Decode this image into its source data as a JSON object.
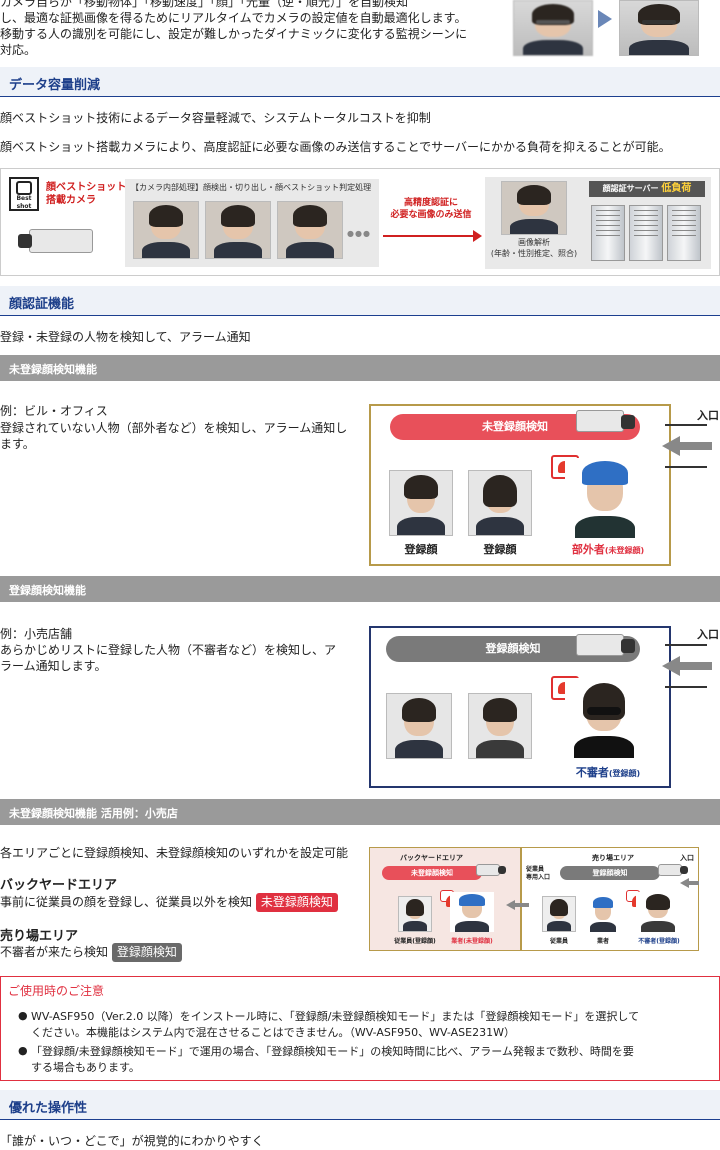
{
  "intro": {
    "line1": "カメラ自らが「移動物体」「移動速度」「顔」「光量（逆・順光）」を自動検知",
    "line2": "し、最適な証拠画像を得るためにリアルタイムでカメラの設定値を自動最適化します。",
    "line3": "移動する人の識別を可能にし、設定が難しかったダイナミックに変化する監視シーンに",
    "line4": "対応。"
  },
  "data_reduction": {
    "title": "データ容量削減",
    "p1": "顔ベストショット技術によるデータ容量軽減で、システムトータルコストを抑制",
    "p2": "顔ベストショット搭載カメラにより、高度認証に必要な画像のみ送信することでサーバーにかかる負荷を抑えることが可能。",
    "diagram": {
      "badge": "Best shot",
      "camera_label_1": "顔ベストショット",
      "camera_label_2": "搭載カメラ",
      "process_label": "【カメラ内部処理】顔検出・切り出し・顔ベストショット判定処理",
      "dots": "●●●",
      "arrow_label_1": "高精度認証に",
      "arrow_label_2": "必要な画像のみ送信",
      "analysis_1": "画像解析",
      "analysis_2": "(年齢・性別推定、照合)",
      "server_label": "顔認証サーバー",
      "server_load": "低負荷"
    }
  },
  "face_auth": {
    "title": "顔認証機能",
    "desc": "登録・未登録の人物を検知して、アラーム通知"
  },
  "unregistered": {
    "header": "未登録顔検知機能",
    "example": "例：ビル・オフィス",
    "desc_1": "登録されていない人物（部外者など）を検知し、アラーム通知し",
    "desc_2": "ます。",
    "pill": "未登録顔検知",
    "entrance": "入口",
    "label_reg1": "登録顔",
    "label_reg2": "登録顔",
    "label_outsider": "部外者",
    "label_outsider_sub": "(未登録顔)"
  },
  "registered": {
    "header": "登録顔検知機能",
    "example": "例：小売店舗",
    "desc_1": "あらかじめリストに登録した人物（不審者など）を検知し、ア",
    "desc_2": "ラーム通知します。",
    "pill": "登録顔検知",
    "entrance": "入口",
    "label_suspicious": "不審者",
    "label_suspicious_sub": "(登録顔)"
  },
  "retail_case": {
    "header": "未登録顔検知機能 活用例：小売店",
    "desc": "各エリアごとに登録顔検知、未登録顔検知のいずれかを設定可能",
    "backyard_title": "バックヤードエリア",
    "backyard_desc": "事前に従業員の顔を登録し、従業員以外を検知",
    "backyard_tag": "未登録顔検知",
    "floor_title": "売り場エリア",
    "floor_desc": "不審者が来たら検知",
    "floor_tag": "登録顔検知",
    "diagram": {
      "backyard_area": "バックヤードエリア",
      "floor_area": "売り場エリア",
      "pill_unreg": "未登録顔検知",
      "pill_reg": "登録顔検知",
      "staff_entrance_1": "従業員",
      "staff_entrance_2": "専用入口",
      "entrance": "入口",
      "l_staff_reg": "従業員",
      "l_staff_reg_sub": "(登録顔)",
      "l_vendor": "業者",
      "l_vendor_sub": "(未登録顔)",
      "l_staff": "従業員",
      "l_vendor2": "業者",
      "l_susp": "不審者",
      "l_susp_sub": "(登録顔)"
    }
  },
  "caution": {
    "title": "ご使用時のご注意",
    "b1_line1": "WV-ASF950（Ver.2.0 以降）をインストール時に、「登録顔/未登録顔検知モード」または「登録顔検知モード」を選択して",
    "b1_line2": "ください。本機能はシステム内で混在させることはできません。（WV-ASF950、WV-ASE231W）",
    "b2_line1": "「登録顔/未登録顔検知モード」で運用の場合、「登録顔検知モード」の検知時間に比べ、アラーム発報まで数秒、時間を要",
    "b2_line2": "する場合もあります。"
  },
  "usability": {
    "title": "優れた操作性",
    "desc": "「誰が・いつ・どこで」が視覚的にわかりやすく"
  },
  "colors": {
    "navy": "#1d3f8a",
    "red": "#e03040",
    "gray_header": "#9a9a9a",
    "pill_red": "#e8505a",
    "pill_gray": "#7a7a7a",
    "frame_gold": "#b79a4a",
    "frame_navy": "#24366e"
  }
}
